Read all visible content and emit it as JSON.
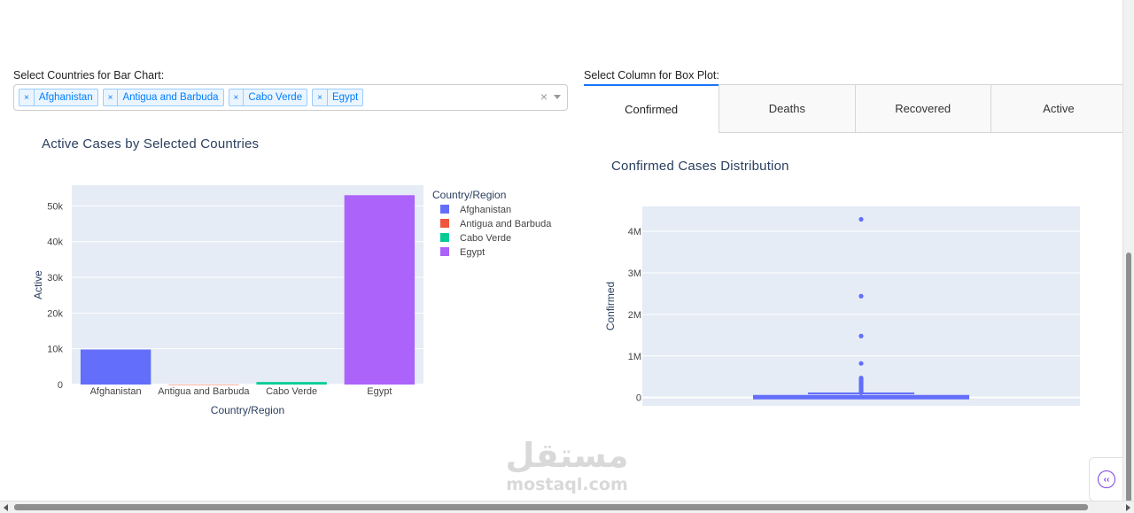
{
  "bar_selector": {
    "label": "Select Countries for Bar Chart:",
    "selected": [
      "Afghanistan",
      "Antigua and Barbuda",
      "Cabo Verde",
      "Egypt"
    ],
    "remove_glyph": "×",
    "clear_glyph": "×"
  },
  "box_selector": {
    "label": "Select Column for Box Plot:",
    "tabs": [
      "Confirmed",
      "Deaths",
      "Recovered",
      "Active"
    ],
    "active_tab": "Confirmed"
  },
  "colors": {
    "plot_bg": "#e5ecf6",
    "afghanistan": "#636efa",
    "antigua": "#ef553b",
    "cabo_verde": "#00cc96",
    "egypt": "#ab63fa",
    "box": "#636efa"
  },
  "chart_data": [
    {
      "type": "bar",
      "title": "Active Cases by Selected Countries",
      "xlabel": "Country/Region",
      "ylabel": "Active",
      "categories": [
        "Afghanistan",
        "Antigua and Barbuda",
        "Cabo Verde",
        "Egypt"
      ],
      "series": [
        {
          "name": "Afghanistan",
          "values": [
            9800,
            null,
            null,
            null
          ]
        },
        {
          "name": "Antigua and Barbuda",
          "values": [
            null,
            20,
            null,
            null
          ]
        },
        {
          "name": "Cabo Verde",
          "values": [
            null,
            null,
            700,
            null
          ]
        },
        {
          "name": "Egypt",
          "values": [
            null,
            null,
            null,
            53000
          ]
        }
      ],
      "legend_title": "Country/Region",
      "legend_position": "right",
      "yticks": [
        "0",
        "10k",
        "20k",
        "30k",
        "40k",
        "50k"
      ],
      "ylim": [
        0,
        55800
      ],
      "grid": true
    },
    {
      "type": "box",
      "title": "Confirmed Cases Distribution",
      "ylabel": "Confirmed",
      "yticks": [
        "0",
        "1M",
        "2M",
        "3M",
        "4M"
      ],
      "ylim": [
        -200000,
        4600000
      ],
      "box": {
        "q1": 0,
        "median": 4000,
        "q3": 40000,
        "upper_fence": 100000
      },
      "outliers": [
        4290000,
        2440000,
        1480000,
        820000,
        470000,
        440000,
        410000,
        380000,
        350000,
        320000,
        290000,
        260000,
        230000,
        200000,
        180000,
        160000,
        140000,
        120000
      ],
      "grid": true
    }
  ],
  "watermark": {
    "arabic": "مستقل",
    "latin": "mostaql.com"
  },
  "debug_button_glyph": "‹‹"
}
